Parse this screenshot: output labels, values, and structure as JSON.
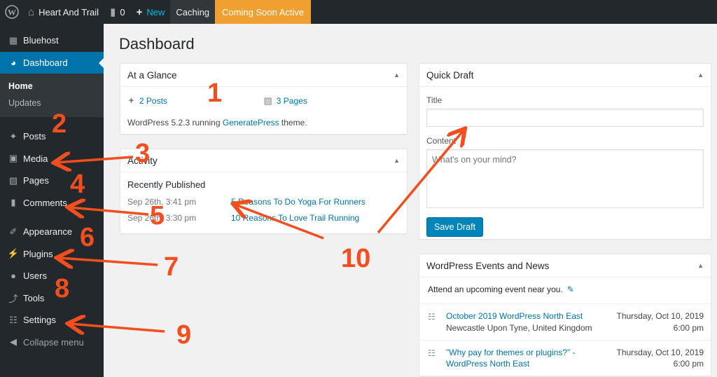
{
  "adminbar": {
    "site_name": "Heart And Trail",
    "comments_count": "0",
    "new_label": "New",
    "caching_label": "Caching",
    "coming_soon_label": "Coming Soon Active",
    "coming_soon_color": "#f0a030"
  },
  "sidebar": {
    "bluehost": "Bluehost",
    "dashboard": "Dashboard",
    "home": "Home",
    "updates": "Updates",
    "posts": "Posts",
    "media": "Media",
    "pages": "Pages",
    "comments": "Comments",
    "appearance": "Appearance",
    "plugins": "Plugins",
    "users": "Users",
    "tools": "Tools",
    "settings": "Settings",
    "collapse": "Collapse menu",
    "active_color": "#0073aa"
  },
  "page_title": "Dashboard",
  "glance": {
    "title": "At a Glance",
    "posts": "2 Posts",
    "pages": "3 Pages",
    "running_prefix": "WordPress 5.2.3 running ",
    "theme": "GeneratePress",
    "running_suffix": " theme."
  },
  "activity": {
    "title": "Activity",
    "recent_title": "Recently Published",
    "items": [
      {
        "date": "Sep 26th, 3:41 pm",
        "title": "5 Reasons To Do Yoga For Runners"
      },
      {
        "date": "Sep 26th, 3:30 pm",
        "title": "10 Reasons To Love Trail Running"
      }
    ]
  },
  "quickdraft": {
    "title": "Quick Draft",
    "title_label": "Title",
    "content_label": "Content",
    "content_placeholder": "What's on your mind?",
    "save_label": "Save Draft"
  },
  "events": {
    "title": "WordPress Events and News",
    "intro": "Attend an upcoming event near you.",
    "items": [
      {
        "name": "October 2019 WordPress North East",
        "location": "Newcastle Upon Tyne, United Kingdom",
        "date": "Thursday, Oct 10, 2019",
        "time": "6:00 pm"
      },
      {
        "name": "\"Why pay for themes or plugins?\" - WordPress North East",
        "location": "",
        "date": "Thursday, Oct 10, 2019",
        "time": "6:00 pm"
      }
    ]
  },
  "annotations": {
    "numbers": [
      "1",
      "2",
      "3",
      "4",
      "5",
      "6",
      "7",
      "8",
      "9",
      "10"
    ],
    "color": "#f24e1e"
  }
}
